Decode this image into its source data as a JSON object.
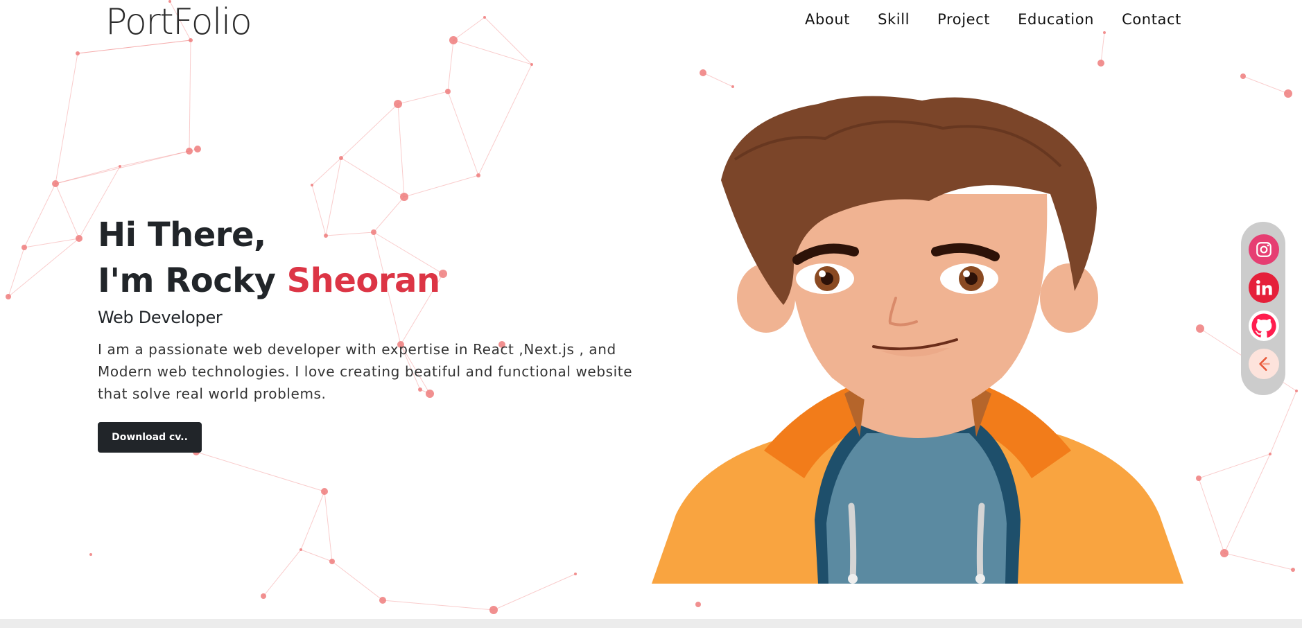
{
  "brand": {
    "logo": "PortFolio"
  },
  "nav": {
    "items": [
      "About",
      "Skill",
      "Project",
      "Education",
      "Contact"
    ]
  },
  "hero": {
    "greeting": "Hi There,",
    "intro_prefix": "I'm Rocky",
    "intro_highlight": "Sheoran",
    "role": "Web Developer",
    "description": "I am a passionate web developer with expertise in React ,Next.js , and Modern web technologies. I love creating beatiful and functional website that solve real world problems.",
    "cta_label": "Download cv.."
  },
  "social": [
    {
      "name": "instagram-icon",
      "color": "#c13584"
    },
    {
      "name": "linkedin-icon",
      "color": "#e5203a"
    },
    {
      "name": "github-icon",
      "color": "#ff1d4e"
    },
    {
      "name": "leetcode-icon",
      "color": "#e8593a"
    }
  ],
  "colors": {
    "accent": "#dc3545",
    "dark": "#212529",
    "network": "#f07b7b"
  }
}
